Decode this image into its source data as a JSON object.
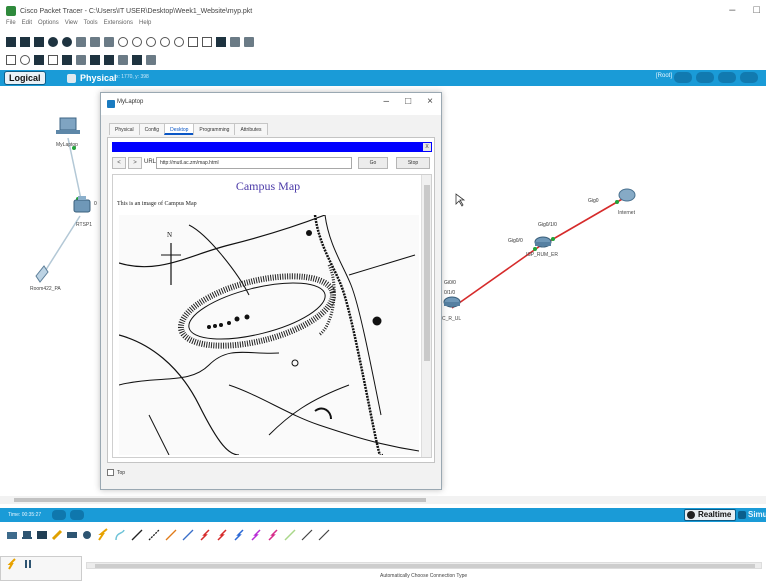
{
  "window": {
    "title": "Cisco Packet Tracer - C:\\Users\\IT USER\\Desktop\\Week1_Website\\myp.pkt",
    "controls": [
      "–",
      "□"
    ]
  },
  "menubar": [
    "File",
    "Edit",
    "Options",
    "View",
    "Tools",
    "Extensions",
    "Help"
  ],
  "viewbar": {
    "logical_label": "Logical",
    "physical_label": "Physical",
    "coords": "x: 1770, y: 398",
    "root_label": "[Root]"
  },
  "devices": [
    {
      "name": "MyLaptop"
    },
    {
      "name": "RTSP1"
    },
    {
      "name": "Room422_PA"
    },
    {
      "name": "ISP_RUM_ER"
    },
    {
      "name": "Internet"
    },
    {
      "name": "C_R_UL"
    }
  ],
  "ports": {
    "isp_left": "Gig0/0",
    "isp_top": "Gig0/1/0",
    "internet_side": "Gig0",
    "c_r_ul_top": "Gi0/0",
    "c_r_ul_second": "0/1/0",
    "rtsp1_edge": "0"
  },
  "dialog": {
    "title": "MyLaptop",
    "controls": [
      "–",
      "□",
      "×"
    ],
    "tabs": [
      "Physical",
      "Config",
      "Desktop",
      "Programming",
      "Attributes"
    ],
    "active_tab": "Desktop",
    "browser": {
      "close_label": "X",
      "back_label": "<",
      "forward_label": ">",
      "url_label": "URL",
      "url_value": "http://mutl.ac.zm/map.html",
      "go_label": "Go",
      "stop_label": "Stop",
      "page_heading": "Campus Map",
      "page_text": "This is an image of Campus Map"
    },
    "top_label": "Top"
  },
  "bottombar": {
    "time": "Time: 00:35:27",
    "realtime_label": "Realtime",
    "simulation_label": "Simulat"
  },
  "palette": {
    "connection_hint": "Automatically Choose Connection Type"
  },
  "colors": {
    "accent_blue": "#1a9bd7",
    "browser_bar": "#0000ff",
    "heading_purple": "#4b3aa8",
    "link_red": "#d62b2b"
  }
}
